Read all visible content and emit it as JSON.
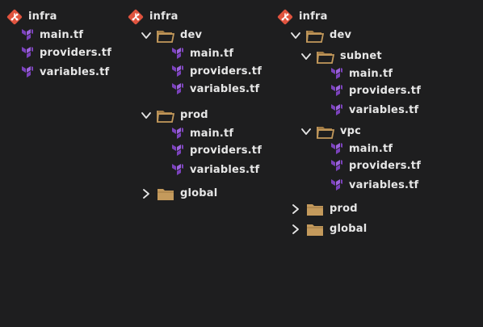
{
  "colors": {
    "background": "#1e1e1f",
    "text": "#e6e6e6",
    "git_red": "#e0533e",
    "terraform_purple": "#7b42bc",
    "folder": "#c49a5c"
  },
  "icons": {
    "repo": "git-icon",
    "file": "terraform-icon",
    "folder": "folder-icon",
    "expanded": "chevron-down-icon",
    "collapsed": "chevron-right-icon"
  },
  "trees": [
    {
      "rows": [
        {
          "type": "repo",
          "label": "infra"
        },
        {
          "type": "file",
          "label": "main.tf"
        },
        {
          "type": "file",
          "label": "providers.tf"
        },
        {
          "type": "file",
          "label": "variables.tf"
        }
      ]
    },
    {
      "rows": [
        {
          "type": "repo",
          "label": "infra"
        },
        {
          "type": "folder",
          "expanded": true,
          "label": "dev"
        },
        {
          "type": "file",
          "label": "main.tf"
        },
        {
          "type": "file",
          "label": "providers.tf"
        },
        {
          "type": "file",
          "label": "variables.tf"
        },
        {
          "type": "folder",
          "expanded": true,
          "label": "prod"
        },
        {
          "type": "file",
          "label": "main.tf"
        },
        {
          "type": "file",
          "label": "providers.tf"
        },
        {
          "type": "file",
          "label": "variables.tf"
        },
        {
          "type": "folder",
          "expanded": false,
          "label": "global"
        }
      ]
    },
    {
      "rows": [
        {
          "type": "repo",
          "label": "infra"
        },
        {
          "type": "folder",
          "expanded": true,
          "label": "dev"
        },
        {
          "type": "folder",
          "expanded": true,
          "label": "subnet"
        },
        {
          "type": "file",
          "label": "main.tf"
        },
        {
          "type": "file",
          "label": "providers.tf"
        },
        {
          "type": "file",
          "label": "variables.tf"
        },
        {
          "type": "folder",
          "expanded": true,
          "label": "vpc"
        },
        {
          "type": "file",
          "label": "main.tf"
        },
        {
          "type": "file",
          "label": "providers.tf"
        },
        {
          "type": "file",
          "label": "variables.tf"
        },
        {
          "type": "folder",
          "expanded": false,
          "label": "prod"
        },
        {
          "type": "folder",
          "expanded": false,
          "label": "global"
        }
      ]
    }
  ]
}
